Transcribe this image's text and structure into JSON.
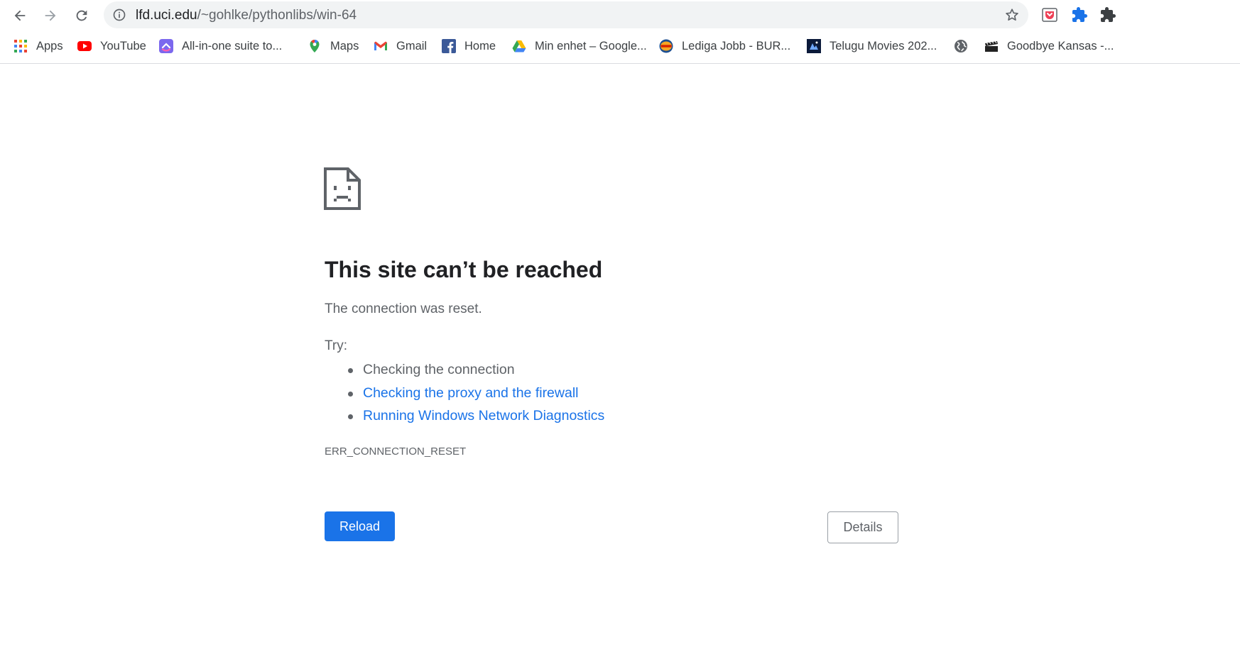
{
  "toolbar": {
    "url_host": "lfd.uci.edu",
    "url_path": "/~gohlke/pythonlibs/win-64"
  },
  "bookmarks": [
    {
      "label": "Apps",
      "icon": "apps-grid-icon"
    },
    {
      "label": "YouTube",
      "icon": "youtube-icon"
    },
    {
      "label": "All-in-one suite to...",
      "icon": "clickup-icon"
    },
    {
      "label": "Maps",
      "icon": "google-maps-icon"
    },
    {
      "label": "Gmail",
      "icon": "gmail-icon"
    },
    {
      "label": "Home",
      "icon": "facebook-icon"
    },
    {
      "label": "Min enhet – Google...",
      "icon": "google-drive-icon"
    },
    {
      "label": "Lediga Jobb - BUR...",
      "icon": "burger-king-icon"
    },
    {
      "label": "Telugu Movies 202...",
      "icon": "movie-site-icon"
    },
    {
      "label": "",
      "icon": "globe-icon"
    },
    {
      "label": "Goodbye Kansas -...",
      "icon": "goodbye-kansas-icon"
    }
  ],
  "error": {
    "title": "This site can’t be reached",
    "description": "The connection was reset.",
    "try_label": "Try:",
    "suggestions": [
      "Checking the connection",
      "Checking the proxy and the firewall",
      "Running Windows Network Diagnostics"
    ],
    "code": "ERR_CONNECTION_RESET"
  },
  "buttons": {
    "reload": "Reload",
    "details": "Details"
  },
  "colors": {
    "accent": "#1a73e8",
    "text_primary": "#202124",
    "text_secondary": "#5f6368"
  }
}
